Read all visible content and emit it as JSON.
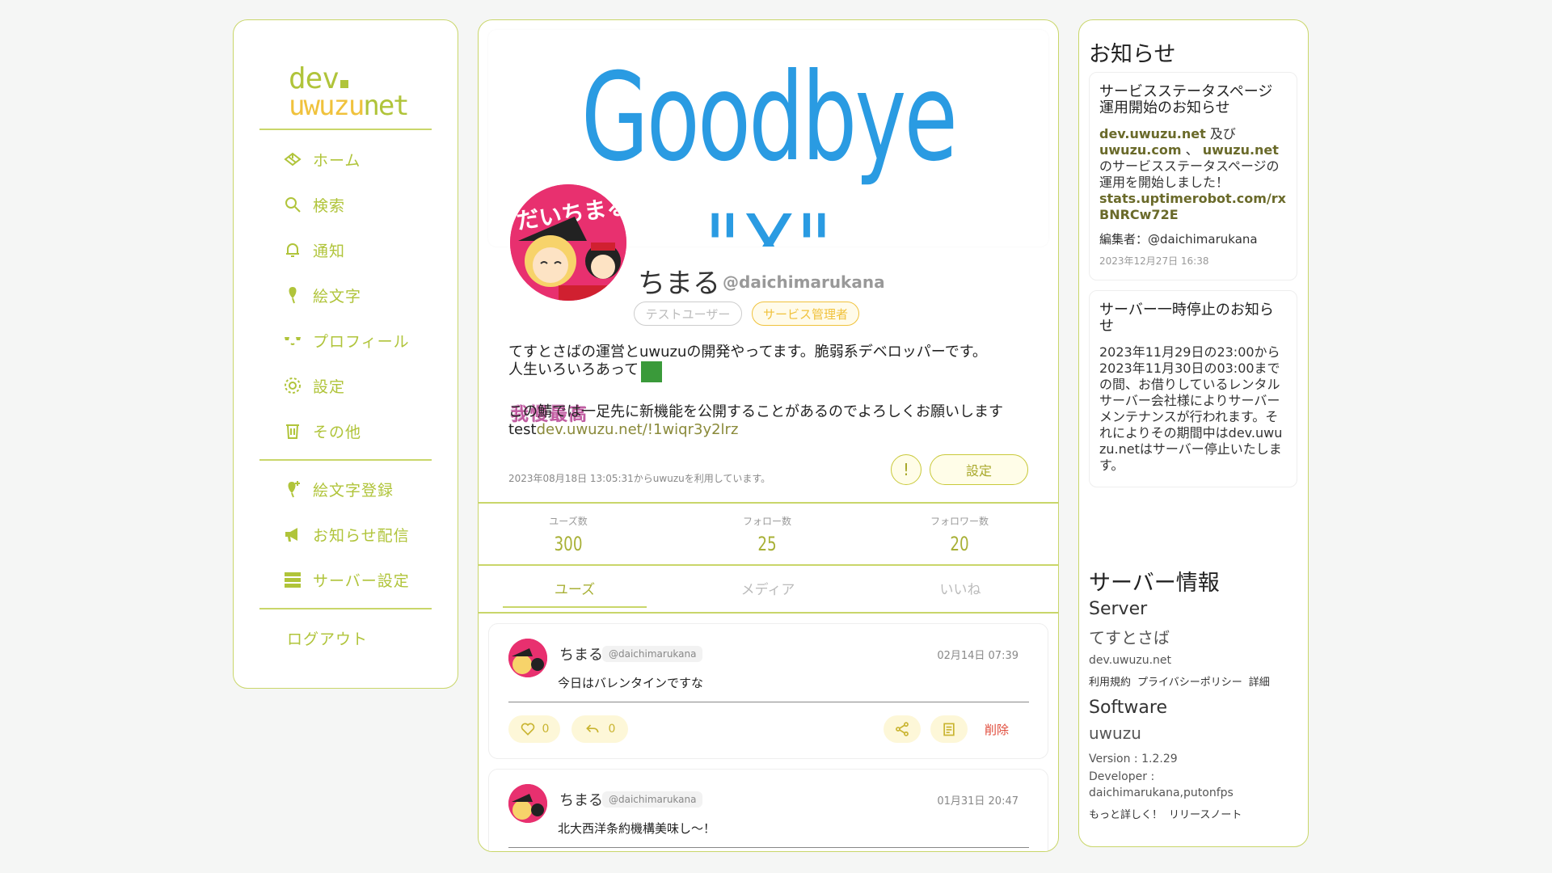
{
  "nav": {
    "logo_line1": "dev",
    "logo_line2a": "uwuzu",
    "logo_line2b": "net",
    "items": [
      {
        "label": "ホーム",
        "icon": "home-icon"
      },
      {
        "label": "検索",
        "icon": "search-icon"
      },
      {
        "label": "通知",
        "icon": "bell-icon"
      },
      {
        "label": "絵文字",
        "icon": "emoji-icon"
      },
      {
        "label": "プロフィール",
        "icon": "profile-icon"
      },
      {
        "label": "設定",
        "icon": "gear-icon"
      },
      {
        "label": "その他",
        "icon": "trash-icon"
      }
    ],
    "admin_items": [
      {
        "label": "絵文字登録",
        "icon": "emoji-add-icon"
      },
      {
        "label": "お知らせ配信",
        "icon": "megaphone-icon"
      },
      {
        "label": "サーバー設定",
        "icon": "server-icon"
      }
    ],
    "logout": "ログアウト"
  },
  "profile": {
    "banner_text_1": "Goodbye",
    "banner_text_2": "\"X\"",
    "avatar_text": "だいちまる",
    "name": "ちまる",
    "handle": "@daichimarukana",
    "badges": [
      "テストユーザー",
      "サービス管理者"
    ],
    "bio_line1": "てすとさばの運営とuwuzuの開発やってます。脆弱系デベロッパーです。",
    "bio_line2": "人生いろいろあって",
    "bio_emoji_text": "我慢最高",
    "bio_line3": "この鯖では一足先に新機能を公開することがあるのでよろしくお願いします",
    "bio_line4_prefix": "test",
    "bio_line4_link": "dev.uwuzu.net/!1wiqr3y2lrz",
    "joined": "2023年08月18日 13:05:31からuwuzuを利用しています。",
    "warn_label": "!",
    "settings_label": "設定",
    "stats": [
      {
        "label": "ユーズ数",
        "value": "300"
      },
      {
        "label": "フォロー数",
        "value": "25"
      },
      {
        "label": "フォロワー数",
        "value": "20"
      }
    ],
    "tabs": [
      "ユーズ",
      "メディア",
      "いいね"
    ]
  },
  "posts": [
    {
      "name": "ちまる",
      "handle": "@daichimarukana",
      "time": "02月14日 07:39",
      "text": "今日はバレンタインですな",
      "likes": "0",
      "reuse": "0",
      "delete": "削除"
    },
    {
      "name": "ちまる",
      "handle": "@daichimarukana",
      "time": "01月31日 20:47",
      "text": "北大西洋条約機構美味し～！"
    }
  ],
  "side": {
    "notice_title": "お知らせ",
    "notices": [
      {
        "title": "サービスステータスページ運用開始のお知らせ",
        "body_a": "dev.uwuzu.net",
        "body_b": " 及び ",
        "body_c": "uwuzu.com",
        "body_d": " 、 ",
        "body_e": "uwuzu.net",
        "body_f": "のサービスステータスページの運用を開始しました！",
        "body_g": "stats.uptimerobot.com/rxBNRCw72E",
        "editor": "編集者：@daichimarukana",
        "date": "2023年12月27日 16:38"
      },
      {
        "title": "サーバー一時停止のお知らせ",
        "body": "2023年11月29日の23:00から2023年11月30日の03:00までの間、お借りしているレンタルサーバー会社様によりサーバーメンテナンスが行われます。それによりその期間中はdev.uwuzu.netはサーバー停止いたします。"
      }
    ],
    "server_title": "サーバー情報",
    "server_heading": "Server",
    "server_name": "てすとさば",
    "server_domain": "dev.uwuzu.net",
    "links": [
      "利用規約",
      "プライバシーポリシー",
      "詳細"
    ],
    "software_heading": "Software",
    "software_name": "uwuzu",
    "version": "Version : 1.2.29",
    "developer_label": "Developer :",
    "developers": "daichimarukana,putonfps",
    "more_links": [
      "もっと詳しく！",
      "リリースノート"
    ]
  },
  "colors": {
    "accent": "#b0c43a",
    "yellow": "#f0c23c",
    "banner_blue": "#2a9be2",
    "delete_red": "#e04a3a"
  }
}
